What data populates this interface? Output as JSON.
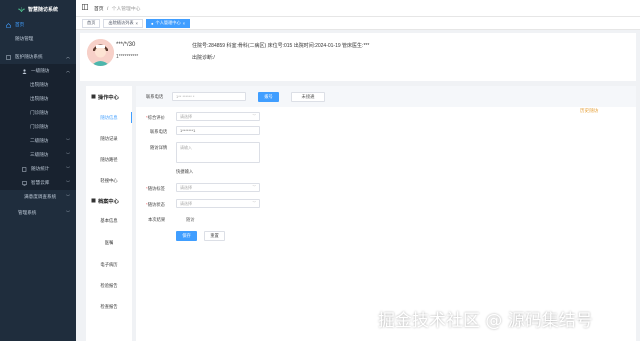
{
  "app": {
    "title": "智慧随访系统"
  },
  "sidebar": {
    "items": [
      {
        "label": "首页"
      },
      {
        "label": "随访管理"
      },
      {
        "label": "医护随访系统"
      },
      {
        "label": "一级随访"
      },
      {
        "label": "出院随访"
      },
      {
        "label": "出院随访"
      },
      {
        "label": "门诊随访"
      },
      {
        "label": "门诊随访"
      },
      {
        "label": "二级随访"
      },
      {
        "label": "三级随访"
      },
      {
        "label": "随访统计"
      },
      {
        "label": "智慧云库"
      },
      {
        "label": "满意度调查系统"
      },
      {
        "label": "管理系统"
      }
    ]
  },
  "header": {
    "breadcrumb_home": "首页",
    "breadcrumb_current": "个人管理中心"
  },
  "tabs": [
    {
      "label": "首页"
    },
    {
      "label": "出院随访列表"
    },
    {
      "label": "个人管理中心"
    }
  ],
  "patient": {
    "name": "***/*/30",
    "phone": "1**********",
    "info": "住院号:284859    科室:骨科(二病区)    床位号:015    出院时间:2024-01-19    管床医生:***",
    "diagnosis": "出院诊断:/"
  },
  "leftmenu": {
    "group1": "操作中心",
    "group1_items": [
      "随访信息",
      "随访记录",
      "随访路径",
      "轻搜中心"
    ],
    "group2": "档案中心",
    "group2_items": [
      "基本信息",
      "医嘱",
      "电子病历",
      "检验报告",
      "检查报告"
    ]
  },
  "form": {
    "contact_label": "联系电话",
    "contact_value": "1** ****** *",
    "dial_button": "拨号",
    "hangup_button": "未接通",
    "history_link": "历史随访",
    "overall_label": "综合评价",
    "overall_placeholder": "请选择",
    "phone_label": "联系电话",
    "phone_value": "1*******1",
    "detail_label": "随访详情",
    "detail_placeholder": "请输入",
    "quick_label": "快捷输入",
    "tag_label": "随访标签",
    "tag_placeholder": "请选择",
    "status_label": "随访状态",
    "status_placeholder": "请选择",
    "result_label": "本次结果",
    "result_value": "随访",
    "save_button": "保存",
    "reset_button": "重置"
  },
  "watermark": "掘金技术社区 @ 源码集结号",
  "colors": {
    "sidebar": "#1f2d3d",
    "primary": "#409eff",
    "accent": "#e6a23c"
  }
}
